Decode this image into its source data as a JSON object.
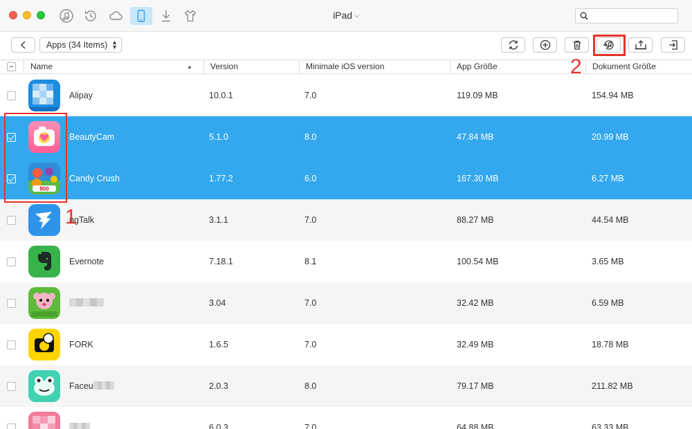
{
  "window": {
    "title": "iPad",
    "search_placeholder": ""
  },
  "toolbar": {
    "category_select": "Apps (34 Items)"
  },
  "annotations": {
    "label_1": "1",
    "label_2": "2"
  },
  "table": {
    "columns": [
      "Name",
      "Version",
      "Minimale iOS version",
      "App Größe",
      "Dokument Größe"
    ],
    "rows": [
      {
        "name": "Alipay",
        "version": "10.0.1",
        "min_ios": "7.0",
        "app_size": "119.09 MB",
        "doc_size": "154.94 MB",
        "selected": false,
        "icon": "alipay-icon"
      },
      {
        "name": "BeautyCam",
        "version": "5.1.0",
        "min_ios": "8.0",
        "app_size": "47.84 MB",
        "doc_size": "20.99 MB",
        "selected": true,
        "icon": "beautycam-icon"
      },
      {
        "name": "Candy Crush",
        "version": "1.77.2",
        "min_ios": "6.0",
        "app_size": "167.30 MB",
        "doc_size": "6.27 MB",
        "selected": true,
        "icon": "candy-crush-icon"
      },
      {
        "name": "ngTalk",
        "version": "3.1.1",
        "min_ios": "7.0",
        "app_size": "88.27 MB",
        "doc_size": "44.54 MB",
        "selected": false,
        "icon": "dingtalk-icon"
      },
      {
        "name": "Evernote",
        "version": "7.18.1",
        "min_ios": "8.1",
        "app_size": "100.54 MB",
        "doc_size": "3.65 MB",
        "selected": false,
        "icon": "evernote-icon"
      },
      {
        "name": "",
        "version": "3.04",
        "min_ios": "7.0",
        "app_size": "32.42 MB",
        "doc_size": "6.59 MB",
        "selected": false,
        "icon": "epet-icon"
      },
      {
        "name": "FORK",
        "version": "1.6.5",
        "min_ios": "7.0",
        "app_size": "32.49 MB",
        "doc_size": "18.78 MB",
        "selected": false,
        "icon": "fork-icon"
      },
      {
        "name": "Faceu",
        "version": "2.0.3",
        "min_ios": "8.0",
        "app_size": "79.17 MB",
        "doc_size": "211.82 MB",
        "selected": false,
        "icon": "faceu-icon"
      },
      {
        "name": "",
        "version": "6.0.3",
        "min_ios": "7.0",
        "app_size": "64.88 MB",
        "doc_size": "63.33 MB",
        "selected": false,
        "icon": "pink-app-icon"
      }
    ]
  },
  "colors": {
    "selection": "#33a8ee",
    "annotation": "#e8322b",
    "active_tab": "#c6e6fb"
  }
}
